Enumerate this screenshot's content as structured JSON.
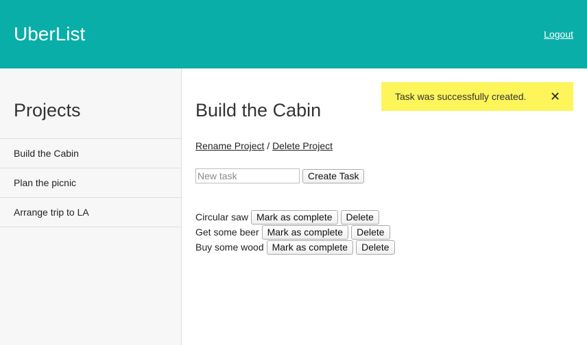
{
  "header": {
    "brand": "UberList",
    "logout_label": "Logout"
  },
  "sidebar": {
    "title": "Projects",
    "projects": [
      {
        "label": "Build the Cabin"
      },
      {
        "label": "Plan the picnic"
      },
      {
        "label": "Arrange trip to LA"
      }
    ]
  },
  "main": {
    "title": "Build the Cabin",
    "rename_label": "Rename Project",
    "separator": "/",
    "delete_project_label": "Delete Project",
    "new_task": {
      "value": "",
      "placeholder": "New task",
      "create_label": "Create Task"
    },
    "tasks": [
      {
        "name": "Circular saw",
        "complete_label": "Mark as complete",
        "delete_label": "Delete"
      },
      {
        "name": "Get some beer",
        "complete_label": "Mark as complete",
        "delete_label": "Delete"
      },
      {
        "name": "Buy some wood",
        "complete_label": "Mark as complete",
        "delete_label": "Delete"
      }
    ]
  },
  "flash": {
    "message": "Task was successfully created.",
    "close_glyph": "✕"
  },
  "colors": {
    "header_bg": "#0aaea8",
    "flash_bg": "#fdf55a",
    "sidebar_bg": "#f7f7f7"
  }
}
